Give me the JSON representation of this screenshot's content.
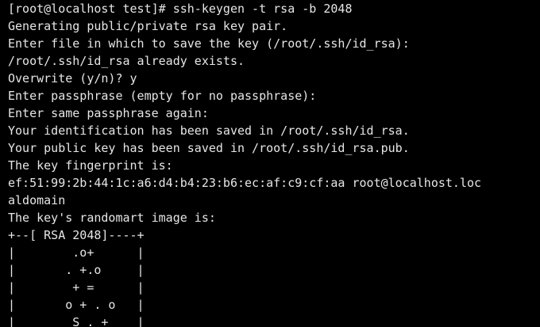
{
  "terminal": {
    "text_color": "#e6e6e6",
    "background_color": "#000000",
    "lines": [
      "[root@localhost test]# ssh-keygen -t rsa -b 2048",
      "Generating public/private rsa key pair.",
      "Enter file in which to save the key (/root/.ssh/id_rsa):",
      "/root/.ssh/id_rsa already exists.",
      "Overwrite (y/n)? y",
      "Enter passphrase (empty for no passphrase):",
      "Enter same passphrase again:",
      "Your identification has been saved in /root/.ssh/id_rsa.",
      "Your public key has been saved in /root/.ssh/id_rsa.pub.",
      "The key fingerprint is:",
      "ef:51:99:2b:44:1c:a6:d4:b4:23:b6:ec:af:c9:cf:aa root@localhost.loc",
      "aldomain",
      "The key's randomart image is:",
      "+--[ RSA 2048]----+",
      "|        .o+      |",
      "|       . +.o     |",
      "|        + =      |",
      "|       o + . o   |",
      "|        S . +    |"
    ]
  }
}
